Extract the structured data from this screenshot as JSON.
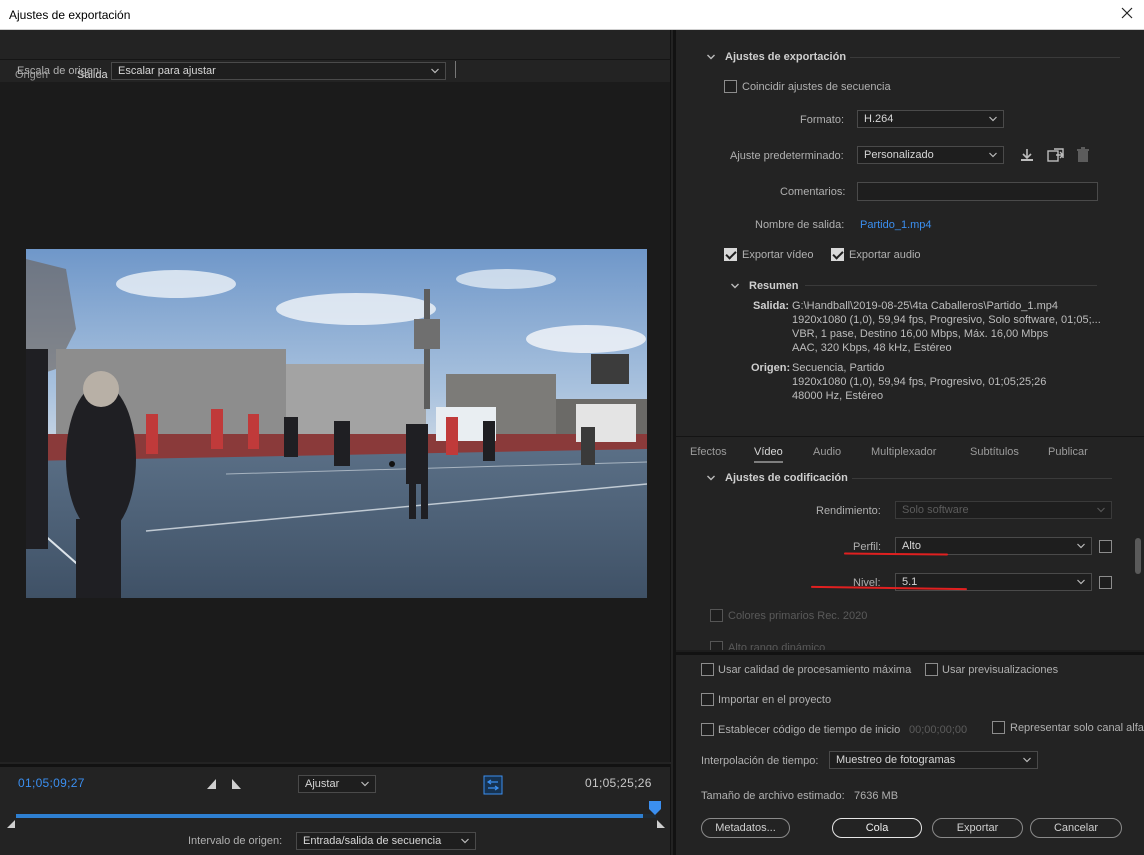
{
  "window": {
    "title": "Ajustes de exportación"
  },
  "left": {
    "tabs": [
      {
        "label": "Origen"
      },
      {
        "label": "Salida"
      }
    ],
    "scale_label": "Escala de origen:",
    "scale_value": "Escalar para ajustar",
    "timeline": {
      "tc_in": "01;05;09;27",
      "tc_out": "01;05;25;26",
      "fit_value": "Ajustar",
      "range_label": "Intervalo de origen:",
      "range_value": "Entrada/salida de secuencia",
      "progress": 0.98
    }
  },
  "export_settings": {
    "section_title": "Ajustes de exportación",
    "match_sequence_label": "Coincidir ajustes de secuencia",
    "format_label": "Formato:",
    "format_value": "H.264",
    "preset_label": "Ajuste predeterminado:",
    "preset_value": "Personalizado",
    "comments_label": "Comentarios:",
    "comments_value": "",
    "output_name_label": "Nombre de salida:",
    "output_name_value": "Partido_1.mp4",
    "export_video_label": "Exportar vídeo",
    "export_audio_label": "Exportar audio",
    "summary": {
      "title": "Resumen",
      "output_label": "Salida:",
      "output_lines": [
        "G:\\Handball\\2019-08-25\\4ta Caballeros\\Partido_1.mp4",
        "1920x1080 (1,0), 59,94 fps, Progresivo, Solo software, 01;05;...",
        "VBR, 1 pase, Destino 16,00 Mbps, Máx. 16,00 Mbps",
        "AAC, 320 Kbps, 48 kHz, Estéreo"
      ],
      "source_label": "Origen:",
      "source_lines": [
        "Secuencia, Partido",
        "1920x1080 (1,0), 59,94 fps, Progresivo, 01;05;25;26",
        "48000 Hz, Estéreo"
      ]
    }
  },
  "settings_tabs": [
    {
      "label": "Efectos"
    },
    {
      "label": "Vídeo"
    },
    {
      "label": "Audio"
    },
    {
      "label": "Multiplexador"
    },
    {
      "label": "Subtítulos"
    },
    {
      "label": "Publicar"
    }
  ],
  "encoding": {
    "section_title": "Ajustes de codificación",
    "performance_label": "Rendimiento:",
    "performance_value": "Solo software",
    "profile_label": "Perfil:",
    "profile_value": "Alto",
    "level_label": "Nivel:",
    "level_value": "5.1",
    "rec2020_label": "Colores primarios Rec. 2020",
    "hdr_label": "Alto rango dinámico"
  },
  "bottom": {
    "max_quality_label": "Usar calidad de procesamiento máxima",
    "use_previews_label": "Usar previsualizaciones",
    "import_label": "Importar en el proyecto",
    "start_tc_label": "Establecer código de tiempo de inicio",
    "start_tc_value": "00;00;00;00",
    "alpha_label": "Representar solo canal alfa",
    "interp_label": "Interpolación de tiempo:",
    "interp_value": "Muestreo de fotogramas",
    "filesize_label": "Tamaño de archivo estimado:",
    "filesize_value": "7636 MB",
    "buttons": {
      "metadata": "Metadatos...",
      "queue": "Cola",
      "export": "Exportar",
      "cancel": "Cancelar"
    }
  },
  "colors": {
    "accent_blue": "#3b8ff0",
    "annotation_red": "#e02020",
    "panel_bg": "#232323"
  }
}
